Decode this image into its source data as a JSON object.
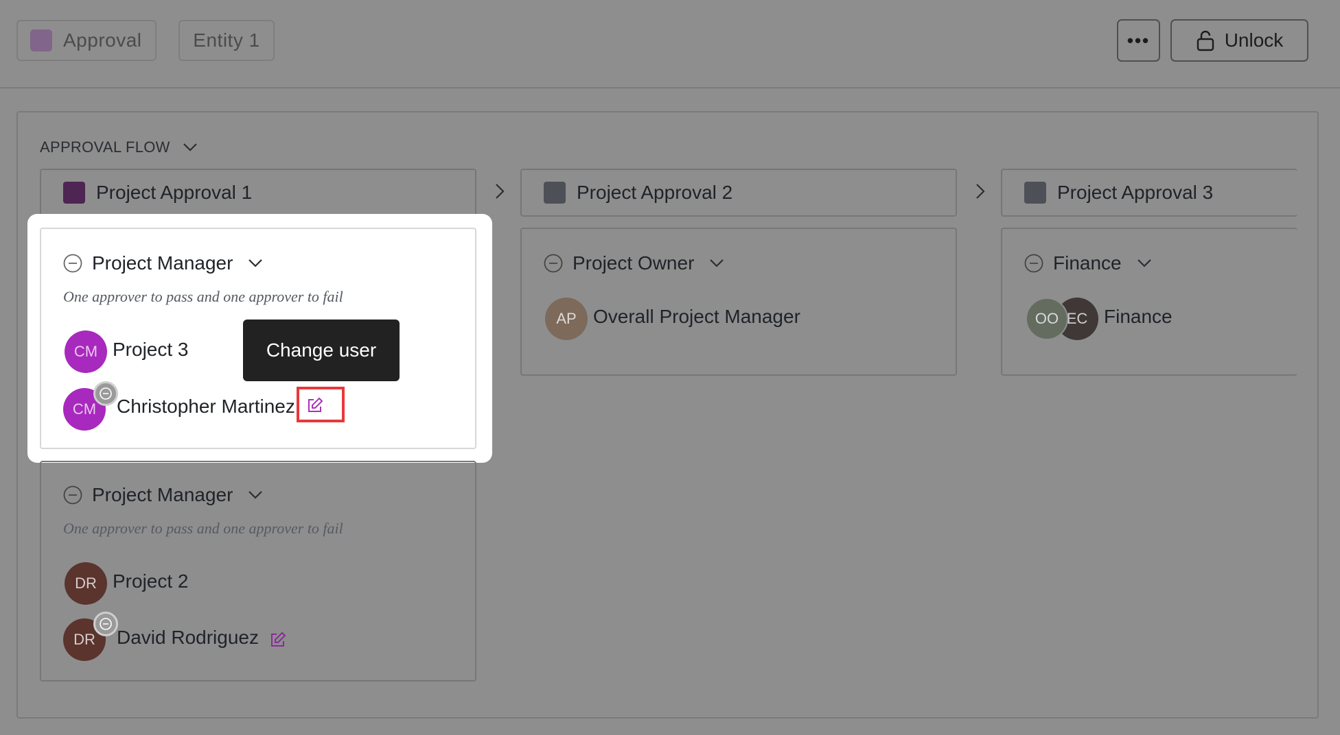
{
  "header": {
    "approval_label": "Approval",
    "entity_label": "Entity 1",
    "more_label": "•••",
    "unlock_label": "Unlock"
  },
  "flow": {
    "title": "APPROVAL FLOW",
    "stages": [
      {
        "name": "Project Approval 1",
        "color": "#4e2553"
      },
      {
        "name": "Project Approval 2",
        "color": "#4d5056"
      },
      {
        "name": "Project Approval 3",
        "color": "#4d5056"
      }
    ]
  },
  "stage1": {
    "groups": [
      {
        "role": "Project Manager",
        "rule": "One approver to pass and one approver to fail",
        "approver": {
          "initials": "CM",
          "label": "Project 3"
        },
        "member": {
          "initials": "CM",
          "name": "Christopher Martinez"
        }
      },
      {
        "role": "Project Manager",
        "rule": "One approver to pass and one approver to fail",
        "approver": {
          "initials": "DR",
          "label": "Project 2"
        },
        "member": {
          "initials": "DR",
          "name": "David Rodriguez"
        }
      }
    ]
  },
  "stage2": {
    "role": "Project Owner",
    "approver": {
      "initials": "AP",
      "label": "Overall Project Manager"
    }
  },
  "stage3": {
    "role": "Finance",
    "approver": {
      "initials_a": "OO",
      "initials_b": "EC",
      "label": "Finance"
    }
  },
  "tooltip": {
    "text": "Change user"
  },
  "colors": {
    "accent": "#e8383b",
    "cm_avatar": "#a829bd",
    "dr_avatar": "#5b342e",
    "edit_icon": "#a833b9"
  }
}
